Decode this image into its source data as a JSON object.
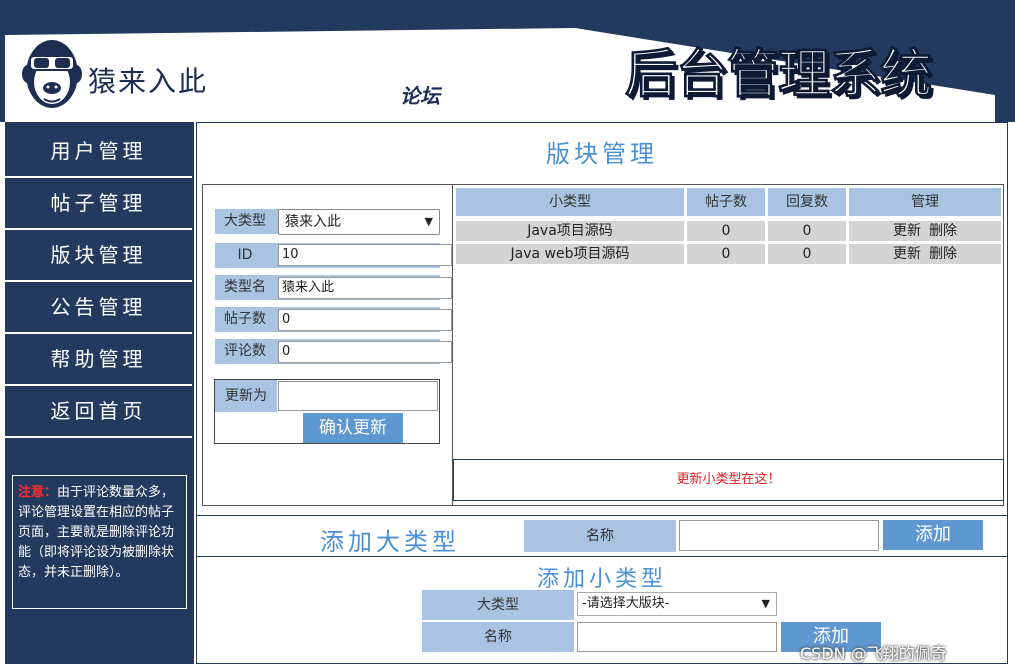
{
  "header": {
    "brand": "猿来入此",
    "forum": "论坛",
    "system_title": "后台管理系统"
  },
  "sidebar": {
    "items": [
      {
        "label": "用户管理"
      },
      {
        "label": "帖子管理"
      },
      {
        "label": "版块管理"
      },
      {
        "label": "公告管理"
      },
      {
        "label": "帮助管理"
      },
      {
        "label": "返回首页"
      }
    ],
    "note_warn": "注意：",
    "note_text": "由于评论数量众多，评论管理设置在相应的帖子页面，主要就是删除评论功能（即将评论设为被删除状态，并未正删除）。"
  },
  "main": {
    "title": "版块管理",
    "form": {
      "type_label": "大类型",
      "type_value": "猿来入此",
      "id_label": "ID",
      "id_value": "10",
      "name_label": "类型名",
      "name_value": "猿来入此",
      "posts_label": "帖子数",
      "posts_value": "0",
      "comments_label": "评论数",
      "comments_value": "0",
      "update_label": "更新为",
      "confirm_label": "确认更新"
    },
    "table": {
      "headers": [
        "小类型",
        "帖子数",
        "回复数",
        "管理"
      ],
      "rows": [
        {
          "name": "Java项目源码",
          "posts": "0",
          "replies": "0"
        },
        {
          "name": "Java web项目源码",
          "posts": "0",
          "replies": "0"
        }
      ],
      "update_action": "更新",
      "delete_action": "删除",
      "hint": "更新小类型在这！"
    },
    "add_big": {
      "title": "添加大类型",
      "name_label": "名称",
      "button": "添加"
    },
    "add_small": {
      "title": "添加小类型",
      "type_label": "大类型",
      "type_placeholder": "-请选择大版块-",
      "name_label": "名称",
      "button": "添加"
    }
  },
  "watermark": "CSDN @飞翔的佩奇"
}
